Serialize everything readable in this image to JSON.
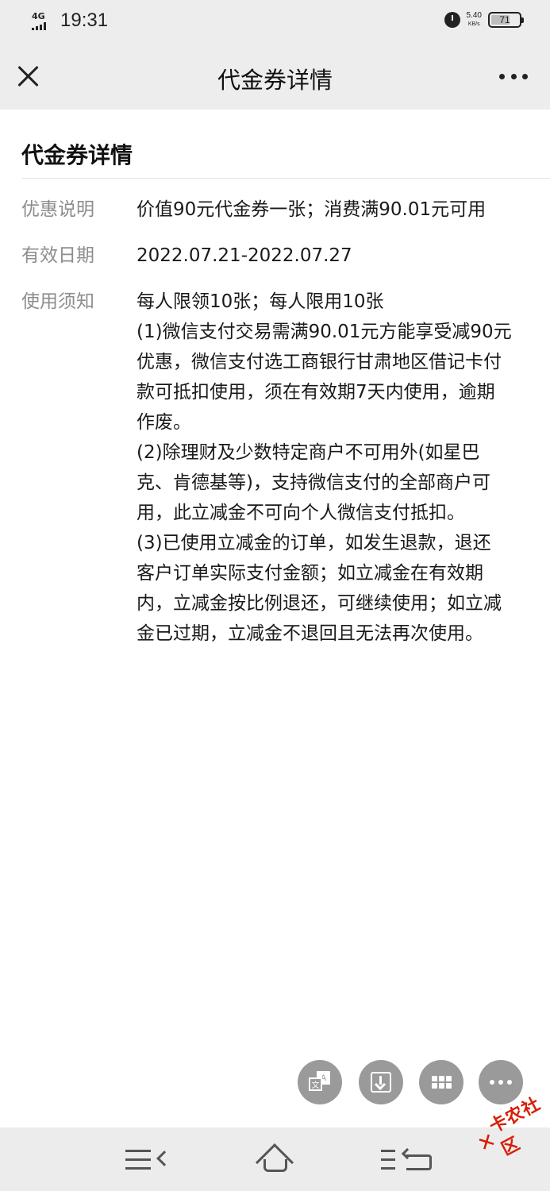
{
  "status_bar": {
    "network": "4G",
    "time": "19:31",
    "speed_value": "5.40",
    "speed_unit": "KB/s",
    "battery": "71",
    "battery_level": 0.71
  },
  "nav": {
    "title": "代金券详情"
  },
  "page": {
    "title": "代金券详情",
    "rows": [
      {
        "label": "优惠说明",
        "value": "价值90元代金券一张；消费满90.01元可用"
      },
      {
        "label": "有效日期",
        "value": "2022.07.21-2022.07.27"
      },
      {
        "label": "使用须知",
        "lines": [
          "每人限领10张；每人限用10张",
          "(1)微信支付交易需满90.01元方能享受减90元",
          "优惠，微信支付选工商银行甘肃地区借记卡付",
          "款可抵扣使用，须在有效期7天内使用，逾期",
          "作废。",
          "(2)除理财及少数特定商户不可用外(如星巴",
          "克、肯德基等)，支持微信支付的全部商户可",
          "用，此立减金不可向个人微信支付抵扣。",
          "(3)已使用立减金的订单，如发生退款，退还",
          "客户订单实际支付金额；如立减金在有效期",
          "内，立减金按比例退还，可继续使用；如立减",
          "金已过期，立减金不退回且无法再次使用。"
        ]
      }
    ]
  },
  "fabs": [
    {
      "icon": "translate-icon",
      "glyph_a": "文",
      "glyph_b": "A"
    },
    {
      "icon": "download-icon"
    },
    {
      "icon": "grid-icon"
    },
    {
      "icon": "more-icon"
    }
  ],
  "watermark": {
    "mark": "✕",
    "text": "卡农社区"
  },
  "colors": {
    "nav_bg": "#ededed",
    "label_gray": "#8d8d8d",
    "fab_gray": "#9a9a9a",
    "watermark_red": "#d81e06"
  }
}
